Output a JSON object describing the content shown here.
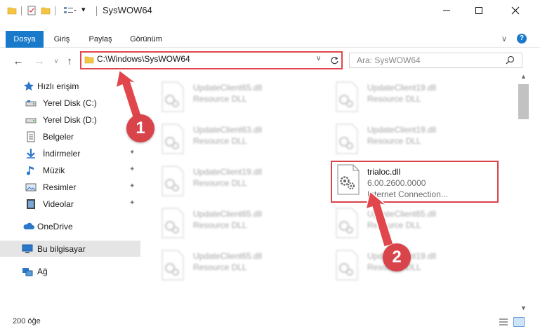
{
  "window": {
    "title": "SysWOW64",
    "minimize_icon": "minimize-icon",
    "maximize_icon": "maximize-icon",
    "close_icon": "close-icon"
  },
  "ribbon": {
    "tabs": [
      "Dosya",
      "Giriş",
      "Paylaş",
      "Görünüm"
    ],
    "file_tab_color": "#1979ca"
  },
  "navigation": {
    "address": "C:\\Windows\\SysWOW64",
    "search_placeholder": "Ara: SysWOW64"
  },
  "sidebar": {
    "items": [
      {
        "label": "Hızlı erişim",
        "icon": "star-icon"
      },
      {
        "label": "Yerel Disk (C:)",
        "icon": "drive-icon"
      },
      {
        "label": "Yerel Disk (D:)",
        "icon": "drive-icon"
      },
      {
        "label": "Belgeler",
        "icon": "documents-icon"
      },
      {
        "label": "İndirmeler",
        "icon": "download-icon"
      },
      {
        "label": "Müzik",
        "icon": "music-icon"
      },
      {
        "label": "Resimler",
        "icon": "pictures-icon"
      },
      {
        "label": "Videolar",
        "icon": "video-icon"
      },
      {
        "label": "OneDrive",
        "icon": "cloud-icon"
      },
      {
        "label": "Bu bilgisayar",
        "icon": "computer-icon"
      },
      {
        "label": "Ağ",
        "icon": "network-icon"
      }
    ]
  },
  "files": [
    {
      "name": "UpdateClient65.dll",
      "desc": "Resource DLL"
    },
    {
      "name": "UpdateClient19.dll",
      "desc": "Resource DLL"
    },
    {
      "name": "UpdateClient63.dll",
      "desc": "Resource DLL"
    },
    {
      "name": "UpdateClient19.dll",
      "desc": "Resource DLL"
    },
    {
      "name": "UpdateClient19.dll",
      "desc": "Resource DLL"
    },
    {
      "name": "trialoc.dll",
      "version": "6.00.2600.0000",
      "desc": "Internet Connection..."
    },
    {
      "name": "UpdateClient65.dll",
      "desc": "Resource DLL"
    },
    {
      "name": "UpdateClient65.dll",
      "desc": "Resource DLL"
    },
    {
      "name": "UpdateClient65.dll",
      "desc": "Resource DLL"
    },
    {
      "name": "UpdateClient19.dll",
      "desc": "Resource DLL"
    }
  ],
  "status": {
    "item_count": "200 öğe"
  },
  "annotations": {
    "badge1": "1",
    "badge2": "2",
    "accent_color": "#d9434a"
  }
}
